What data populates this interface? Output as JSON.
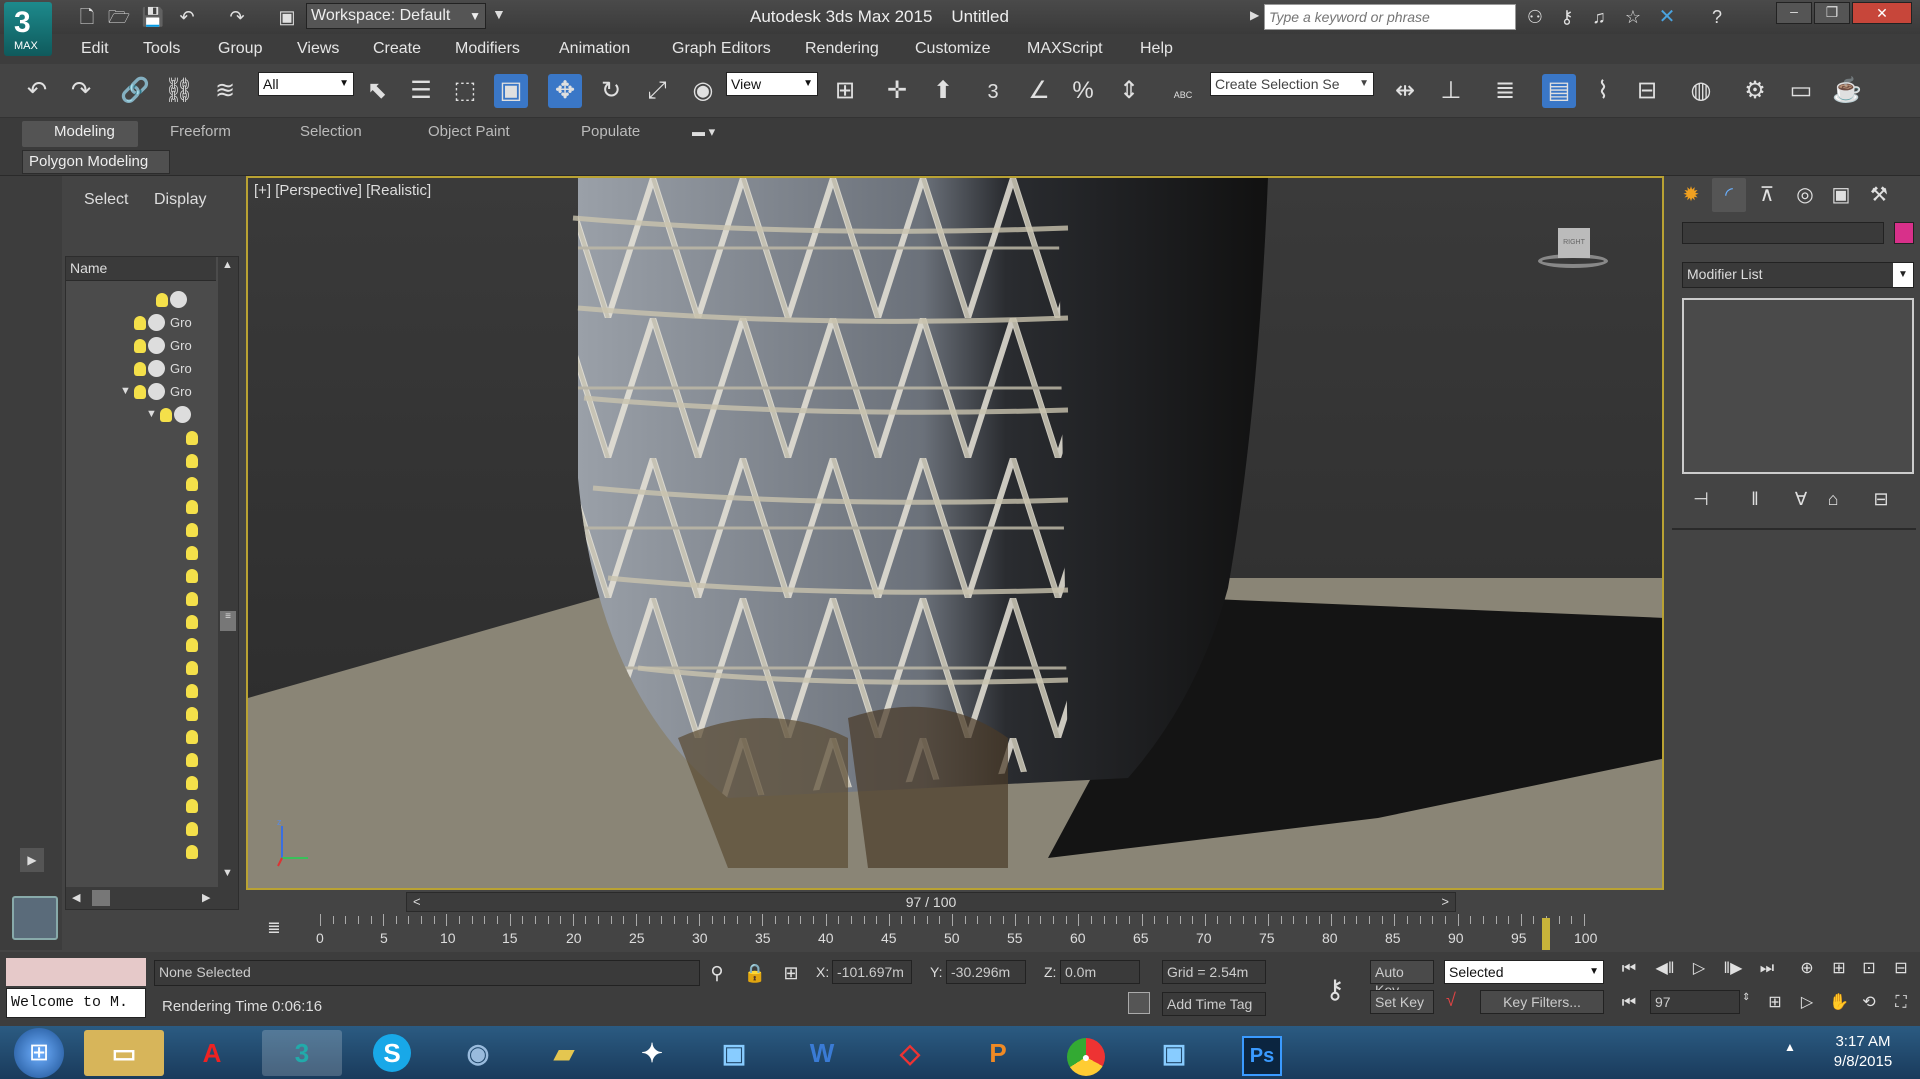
{
  "title": {
    "workspace": "Workspace: Default",
    "app": "Autodesk 3ds Max 2015",
    "doc": "Untitled",
    "search_placeholder": "Type a keyword or phrase",
    "logo": "MAX"
  },
  "menu": [
    "Edit",
    "Tools",
    "Group",
    "Views",
    "Create",
    "Modifiers",
    "Animation",
    "Graph Editors",
    "Rendering",
    "Customize",
    "MAXScript",
    "Help"
  ],
  "toolbar": {
    "filter": "All",
    "refcoord": "View",
    "selset": "Create Selection Se",
    "snap3": "3",
    "abc": "ABC"
  },
  "ribbon": {
    "tabs": [
      "Modeling",
      "Freeform",
      "Selection",
      "Object Paint",
      "Populate"
    ],
    "sub": "Polygon Modeling"
  },
  "scene": {
    "tabs": [
      "Select",
      "Display"
    ],
    "col_name": "Name",
    "groups": [
      "Gro",
      "Gro",
      "Gro",
      "Gro"
    ]
  },
  "viewport": {
    "label": "[+] [Perspective] [Realistic]",
    "viewcube": "RIGHT"
  },
  "cmd": {
    "modifier_list": "Modifier List",
    "accent": "#d8308a"
  },
  "timeline": {
    "frame": "97 / 100",
    "labels": [
      "0",
      "5",
      "10",
      "15",
      "20",
      "25",
      "30",
      "35",
      "40",
      "45",
      "50",
      "55",
      "60",
      "65",
      "70",
      "75",
      "80",
      "85",
      "90",
      "95",
      "100"
    ],
    "position": 0.97
  },
  "status": {
    "selected": "None Selected",
    "render_time": "Rendering Time  0:06:16",
    "welcome": "Welcome to M.",
    "x_label": "X:",
    "x": "-101.697m",
    "y_label": "Y:",
    "y": "-30.296m",
    "z_label": "Z:",
    "z": "0.0m",
    "grid": "Grid = 2.54m",
    "add_time_tag": "Add Time Tag",
    "auto_key": "Auto Key",
    "set_key": "Set Key",
    "selected_dd": "Selected",
    "key_filters": "Key Filters...",
    "frame": "97"
  },
  "taskbar": {
    "time": "3:17 AM",
    "date": "9/8/2015"
  }
}
